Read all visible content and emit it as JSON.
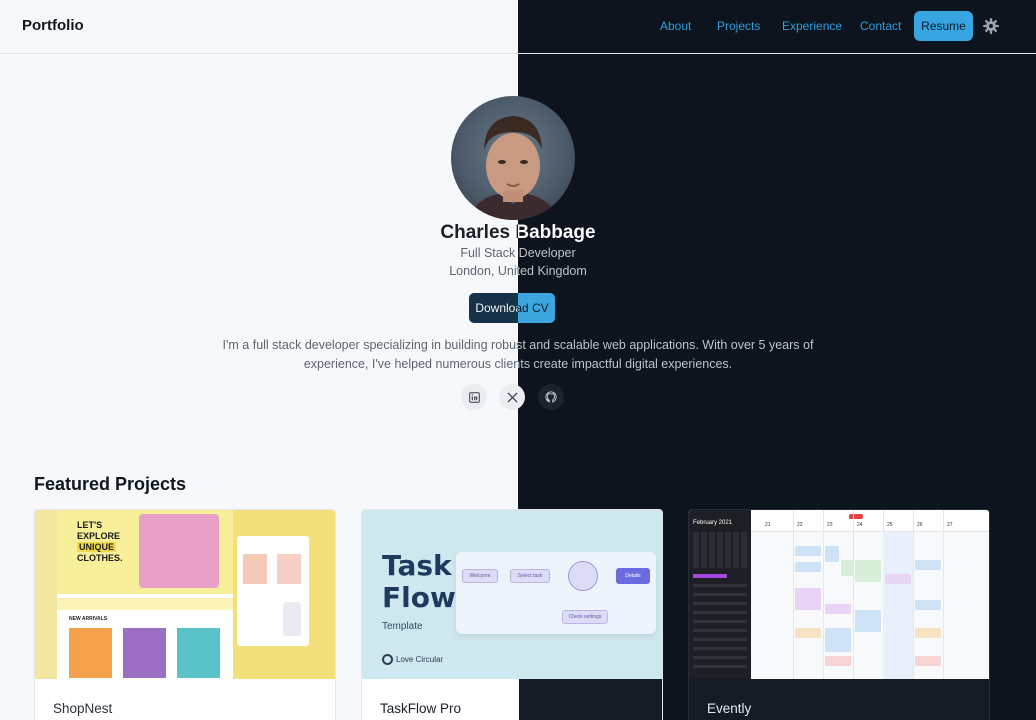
{
  "header": {
    "brand": "Portfolio",
    "nav": [
      "About",
      "Projects",
      "Experience",
      "Contact"
    ],
    "resume_label": "Resume",
    "settings_icon": "gear-icon"
  },
  "hero": {
    "name": "Charles Babbage",
    "role": "Full Stack Developer",
    "location": "London, United Kingdom",
    "cta_label": "Download CV",
    "bio": "I'm a full stack developer specializing in building robust and scalable web applications. With over 5 years of experience, I've helped numerous clients create impactful digital experiences.",
    "social": [
      {
        "icon": "linkedin-icon"
      },
      {
        "icon": "x-icon"
      },
      {
        "icon": "github-icon"
      }
    ]
  },
  "featured": {
    "title": "Featured Projects",
    "projects": [
      {
        "title": "ShopNest",
        "thumb": {
          "headline_1": "LET'S",
          "headline_2": "EXPLORE",
          "headline_3": "UNIQUE",
          "headline_4": "CLOTHES.",
          "section": "NEW ARRIVALS"
        }
      },
      {
        "title": "TaskFlow Pro",
        "thumb": {
          "word_1": "Task",
          "word_2": "Flow",
          "subtitle": "Template",
          "brand": "Love Circular",
          "steps": [
            "Welcome",
            "Select task",
            "Details",
            "Check settings"
          ]
        }
      },
      {
        "title": "Evently",
        "thumb": {
          "month": "February 2021",
          "days": [
            "21",
            "22",
            "23",
            "24",
            "25",
            "26",
            "27"
          ]
        }
      }
    ]
  },
  "colors": {
    "accent": "#38a5e3",
    "light_bg": "#f6f8fb",
    "dark_bg": "#0e141d"
  }
}
